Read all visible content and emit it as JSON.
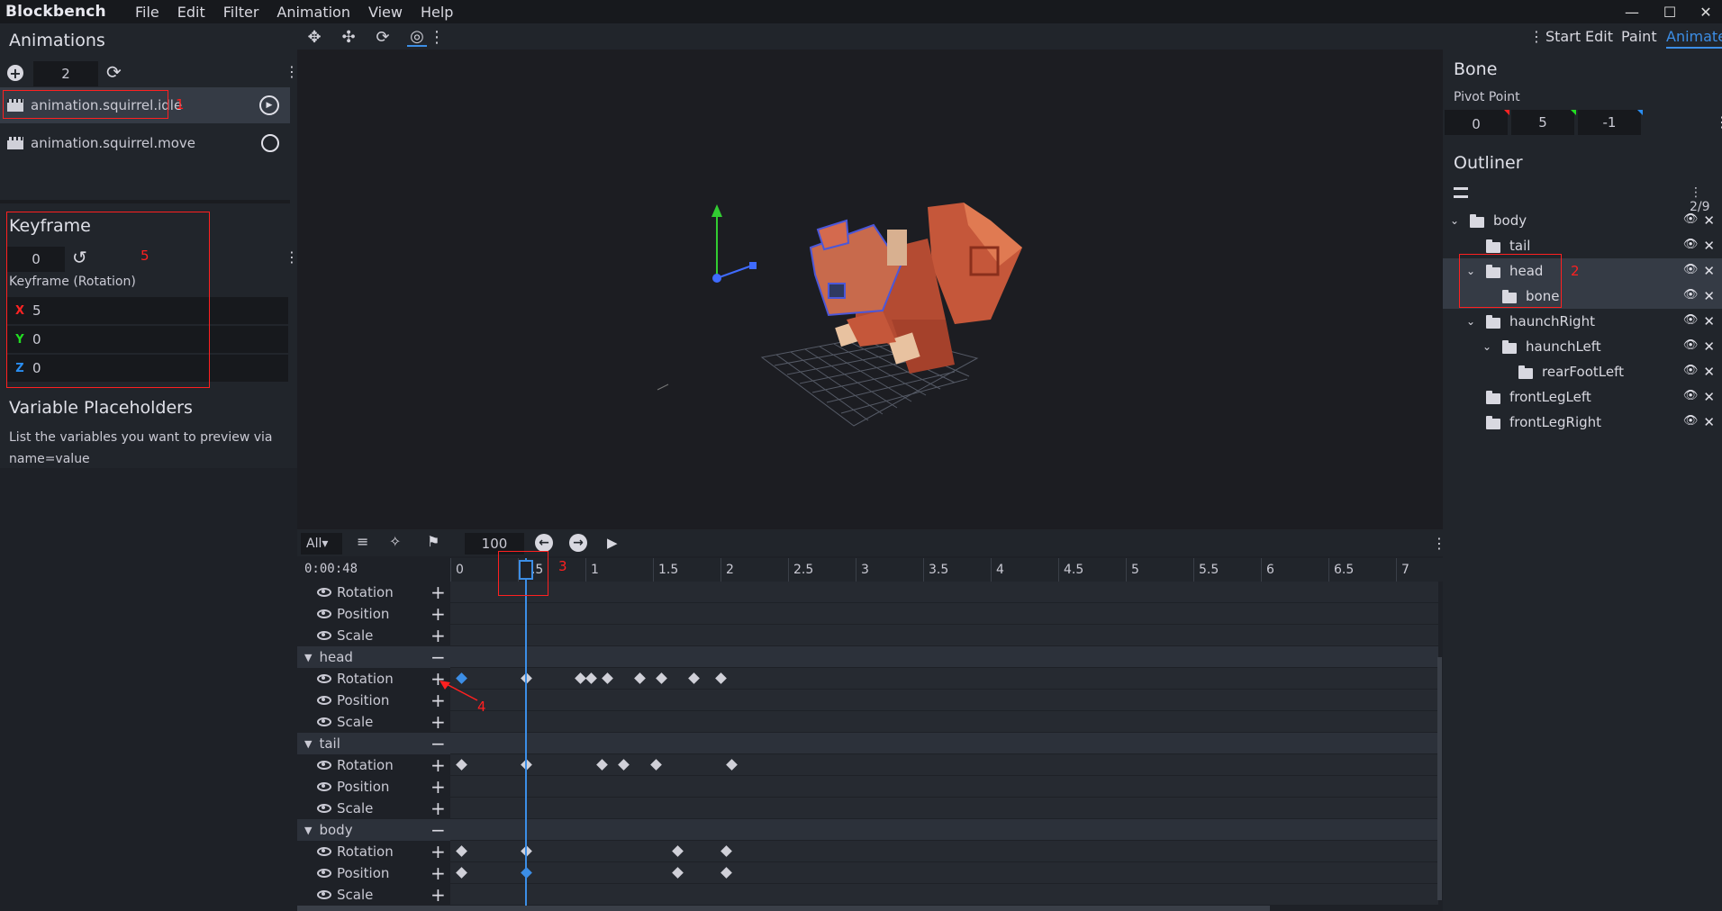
{
  "titlebar": {
    "app_name": "Blockbench",
    "menu": [
      "File",
      "Edit",
      "Filter",
      "Animation",
      "View",
      "Help"
    ],
    "controls": [
      "—",
      "☐",
      "✕"
    ]
  },
  "modes": [
    "Start",
    "Edit",
    "Paint",
    "Animate"
  ],
  "animations": {
    "title": "Animations",
    "count_value": "2",
    "items": [
      {
        "label": "animation.squirrel.idle",
        "selected": true
      },
      {
        "label": "animation.squirrel.move",
        "selected": false
      }
    ]
  },
  "keyframe": {
    "title": "Keyframe",
    "time_value": "0",
    "channel_label": "Keyframe (Rotation)",
    "axes": [
      {
        "axis": "X",
        "value": "5",
        "color": "#ff2323"
      },
      {
        "axis": "Y",
        "value": "0",
        "color": "#22dd22"
      },
      {
        "axis": "Z",
        "value": "0",
        "color": "#2a8df0"
      }
    ]
  },
  "placeholders": {
    "title": "Variable Placeholders",
    "hint": "List the variables you want to preview via name=value"
  },
  "bone": {
    "title": "Bone",
    "pivot_label": "Pivot Point",
    "pivot": [
      "0",
      "5",
      "-1"
    ]
  },
  "outliner": {
    "title": "Outliner",
    "count": "2/9",
    "items": [
      {
        "label": "body",
        "indent": 0,
        "expand": "open"
      },
      {
        "label": "tail",
        "indent": 1,
        "expand": "none"
      },
      {
        "label": "head",
        "indent": 1,
        "expand": "open",
        "selected": true
      },
      {
        "label": "bone",
        "indent": 2,
        "expand": "none",
        "selected": true
      },
      {
        "label": "haunchRight",
        "indent": 1,
        "expand": "open"
      },
      {
        "label": "haunchLeft",
        "indent": 2,
        "expand": "open"
      },
      {
        "label": "rearFootLeft",
        "indent": 3,
        "expand": "none"
      },
      {
        "label": "frontLegLeft",
        "indent": 1,
        "expand": "none"
      },
      {
        "label": "frontLegRight",
        "indent": 1,
        "expand": "none"
      }
    ]
  },
  "timeline": {
    "filter": "All",
    "zoom_value": "100",
    "timecode": "0:00:48",
    "ruler": [
      "0",
      "0.5",
      "1",
      "1.5",
      "2",
      "2.5",
      "3",
      "3.5",
      "4",
      "4.5",
      "5",
      "5.5",
      "6",
      "6.5",
      "7"
    ],
    "playhead_time": 0.48,
    "rows": [
      {
        "label": "Rotation",
        "kind": "channel",
        "keyframes": []
      },
      {
        "label": "Position",
        "kind": "channel",
        "keyframes": []
      },
      {
        "label": "Scale",
        "kind": "channel",
        "keyframes": []
      },
      {
        "label": "head",
        "kind": "group"
      },
      {
        "label": "Rotation",
        "kind": "channel",
        "keyframes": [
          0,
          0.48,
          0.88,
          0.96,
          1.08,
          1.32,
          1.48,
          1.72,
          1.92
        ],
        "selected": [
          0
        ]
      },
      {
        "label": "Position",
        "kind": "channel",
        "keyframes": []
      },
      {
        "label": "Scale",
        "kind": "channel",
        "keyframes": []
      },
      {
        "label": "tail",
        "kind": "group"
      },
      {
        "label": "Rotation",
        "kind": "channel",
        "keyframes": [
          0,
          0.48,
          1.04,
          1.2,
          1.44,
          2.0
        ]
      },
      {
        "label": "Position",
        "kind": "channel",
        "keyframes": []
      },
      {
        "label": "Scale",
        "kind": "channel",
        "keyframes": []
      },
      {
        "label": "body",
        "kind": "group"
      },
      {
        "label": "Rotation",
        "kind": "channel",
        "keyframes": [
          0,
          0.48,
          1.6,
          1.96
        ]
      },
      {
        "label": "Position",
        "kind": "channel",
        "keyframes": [
          0,
          0.48,
          1.6,
          1.96
        ],
        "selected": [
          1
        ]
      },
      {
        "label": "Scale",
        "kind": "channel",
        "keyframes": []
      }
    ]
  },
  "annotations": [
    "1",
    "2",
    "3",
    "4",
    "5"
  ],
  "colors": {
    "accent": "#3c8ee6",
    "annotation": "#ff2020"
  }
}
